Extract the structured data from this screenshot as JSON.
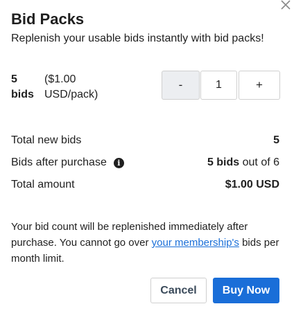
{
  "dialog": {
    "title": "Bid Packs",
    "subtitle": "Replenish your usable bids instantly with bid packs!",
    "close_icon": "close-icon"
  },
  "pack": {
    "count_label": "5 bids",
    "price_label": "($1.00 USD/pack)"
  },
  "stepper": {
    "minus_label": "-",
    "quantity": "1",
    "plus_label": "+"
  },
  "summary": {
    "total_new_bids_label": "Total new bids",
    "total_new_bids_value": "5",
    "bids_after_label": "Bids after purchase",
    "bids_after_value": "5 bids",
    "bids_after_suffix": "out of 6",
    "info_icon": "info-icon",
    "total_amount_label": "Total amount",
    "total_amount_value": "$1.00 USD"
  },
  "notice": {
    "text_before": "Your bid count will be replenished immediately after purchase. You cannot go over ",
    "link_text": "your membership's",
    "text_after": " bids per month limit."
  },
  "actions": {
    "cancel_label": "Cancel",
    "buy_label": "Buy Now"
  },
  "colors": {
    "accent": "#1a6ed8",
    "text": "#1f1f1f"
  }
}
